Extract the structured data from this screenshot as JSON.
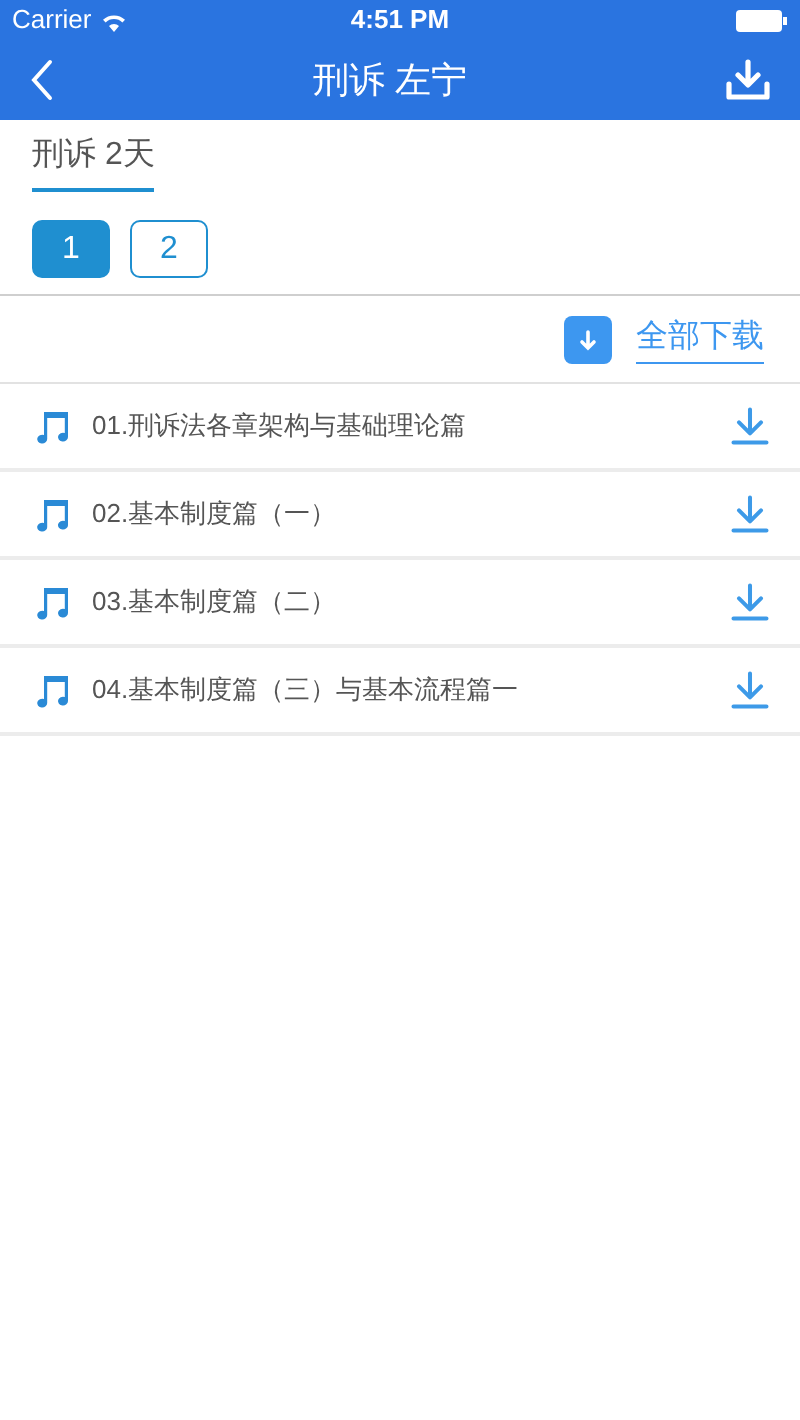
{
  "status_bar": {
    "carrier": "Carrier",
    "time": "4:51 PM"
  },
  "nav": {
    "title": "刑诉 左宁"
  },
  "course_tab": {
    "label": "刑诉 2天",
    "selected": true
  },
  "pages": [
    {
      "label": "1",
      "selected": true
    },
    {
      "label": "2",
      "selected": false
    }
  ],
  "download_all": {
    "label": "全部下载"
  },
  "lessons": [
    {
      "title": "01.刑诉法各章架构与基础理论篇"
    },
    {
      "title": "02.基本制度篇（一）"
    },
    {
      "title": "03.基本制度篇（二）"
    },
    {
      "title": "04.基本制度篇（三）与基本流程篇一"
    }
  ]
}
